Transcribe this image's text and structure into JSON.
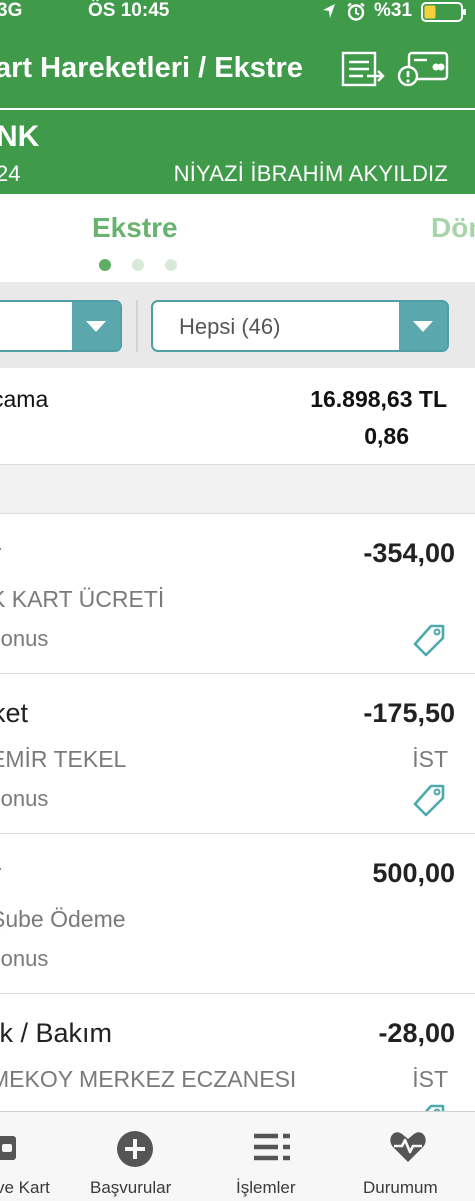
{
  "status_bar": {
    "carrier": "3G",
    "time": "ÖS 10:45",
    "battery": "%31",
    "icons": [
      "location-arrow-icon",
      "alarm-icon",
      "battery-icon"
    ]
  },
  "header": {
    "title": "art Hareketleri / Ekstre",
    "icons": [
      "statement-export-icon",
      "card-alert-icon"
    ]
  },
  "account": {
    "bank": "NK",
    "card_suffix": "24",
    "owner": "NİYAZİ İBRAHİM AKYILDIZ"
  },
  "tabs": {
    "active": "Ekstre",
    "next": "Dön",
    "page_dots": 3,
    "active_dot": 0
  },
  "filters": {
    "left_value": "",
    "right_value": "Hepsi (46)"
  },
  "summary": {
    "label": "cama",
    "amount": "16.898,63 TL",
    "rate": "0,86"
  },
  "transactions": [
    {
      "category": "r",
      "amount": "-354,00",
      "merchant": "K KART ÜCRETİ",
      "city": "",
      "bonus": "Bonus",
      "tag": true
    },
    {
      "category": "ket",
      "amount": "-175,50",
      "merchant": "EMİR TEKEL",
      "city": "İST",
      "bonus": "Bonus",
      "tag": true
    },
    {
      "category": "r",
      "amount": "500,00",
      "merchant": "Şube Ödeme",
      "city": "",
      "bonus": "Bonus",
      "tag": false
    },
    {
      "category": "ık / Bakım",
      "amount": "-28,00",
      "merchant": "MEKOY MERKEZ ECZANESI",
      "city": "İST",
      "bonus": "",
      "tag": true
    }
  ],
  "tabbar": {
    "items": [
      {
        "label": "ve Kart",
        "icon": "wallet-icon"
      },
      {
        "label": "Başvurular",
        "icon": "plus-circle-icon"
      },
      {
        "label": "İşlemler",
        "icon": "list-icon"
      },
      {
        "label": "Durumum",
        "icon": "heart-pulse-icon"
      }
    ]
  },
  "colors": {
    "brand_green": "#3f9a4a",
    "tab_green": "#67b36d",
    "teal": "#5aa8ae"
  }
}
